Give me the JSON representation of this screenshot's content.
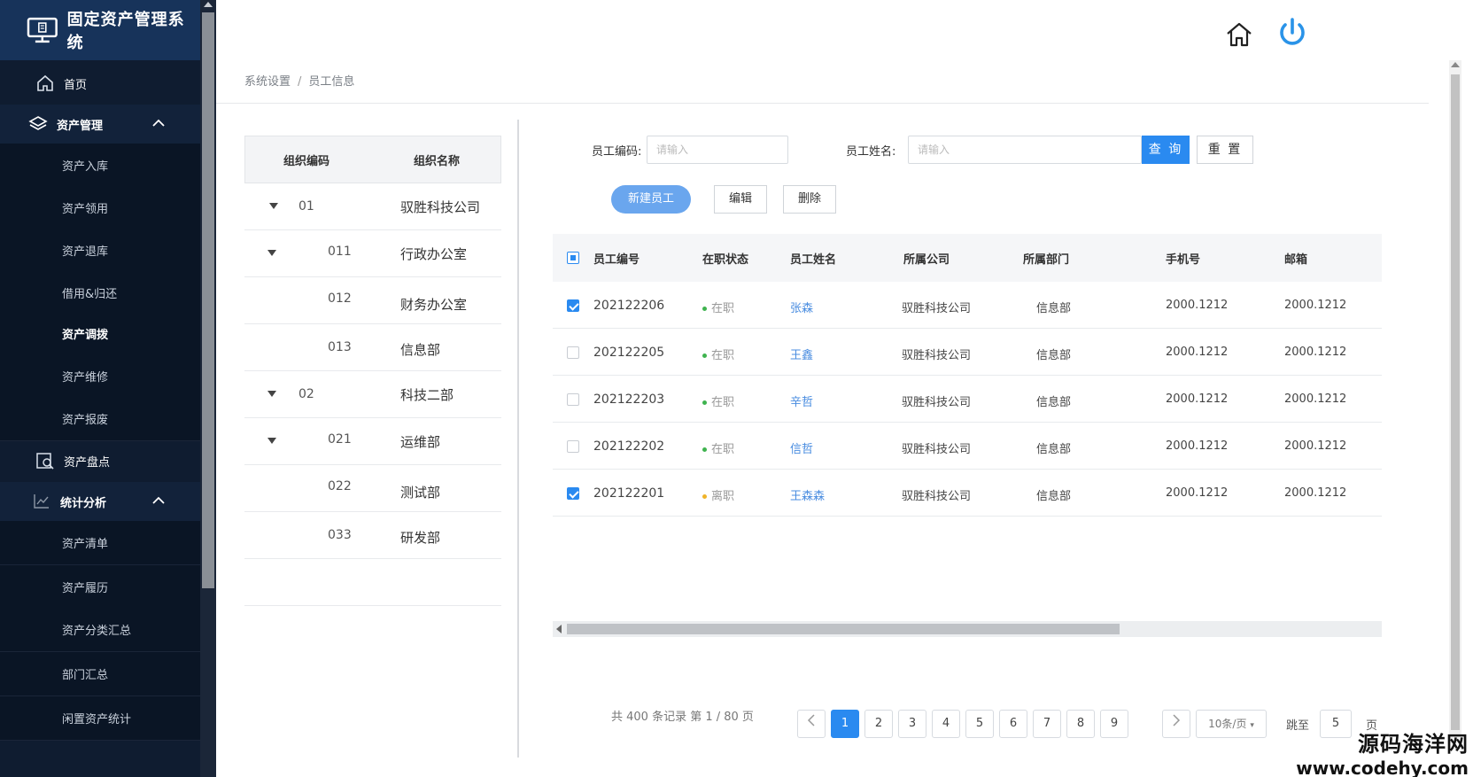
{
  "app": {
    "title": "固定资产管理系统"
  },
  "sidebar": {
    "home": "首页",
    "asset_mgmt": "资产管理",
    "asset_sub": [
      "资产入库",
      "资产领用",
      "资产退库",
      "借用&归还",
      "资产调拨",
      "资产维修",
      "资产报废"
    ],
    "inventory": "资产盘点",
    "stats": "统计分析",
    "stats_sub": [
      "资产清单",
      "资产履历",
      "资产分类汇总",
      "部门汇总",
      "闲置资产统计"
    ]
  },
  "breadcrumb": {
    "parent": "系统设置",
    "sep": "/",
    "current": "员工信息"
  },
  "org": {
    "col_code": "组织编码",
    "col_name": "组织名称",
    "rows": [
      {
        "code": "01",
        "name": "驭胜科技公司"
      },
      {
        "code": "011",
        "name": "行政办公室"
      },
      {
        "code": "012",
        "name": "财务办公室"
      },
      {
        "code": "013",
        "name": "信息部"
      },
      {
        "code": "02",
        "name": "科技二部"
      },
      {
        "code": "021",
        "name": "运维部"
      },
      {
        "code": "022",
        "name": "测试部"
      },
      {
        "code": "033",
        "name": "研发部"
      }
    ]
  },
  "search": {
    "code_label": "员工编码:",
    "code_placeholder": "请输入",
    "name_label": "员工姓名:",
    "name_placeholder": "请输入",
    "query": "查 询",
    "reset": "重 置"
  },
  "actions": {
    "new": "新建员工",
    "edit": "编辑",
    "delete": "删除"
  },
  "table": {
    "headers": [
      "员工编号",
      "在职状态",
      "员工姓名",
      "所属公司",
      "所属部门",
      "手机号",
      "邮箱"
    ],
    "rows": [
      {
        "checked": true,
        "id": "202122206",
        "status": "在职",
        "status_color": "#3fb34f",
        "name": "张森",
        "company": "驭胜科技公司",
        "dept": "信息部",
        "phone": "2000.1212",
        "email": "2000.1212"
      },
      {
        "checked": false,
        "id": "202122205",
        "status": "在职",
        "status_color": "#3fb34f",
        "name": "王鑫",
        "company": "驭胜科技公司",
        "dept": "信息部",
        "phone": "2000.1212",
        "email": "2000.1212"
      },
      {
        "checked": false,
        "id": "202122203",
        "status": "在职",
        "status_color": "#3fb34f",
        "name": "辛哲",
        "company": "驭胜科技公司",
        "dept": "信息部",
        "phone": "2000.1212",
        "email": "2000.1212"
      },
      {
        "checked": false,
        "id": "202122202",
        "status": "在职",
        "status_color": "#3fb34f",
        "name": "信哲",
        "company": "驭胜科技公司",
        "dept": "信息部",
        "phone": "2000.1212",
        "email": "2000.1212"
      },
      {
        "checked": true,
        "id": "202122201",
        "status": "离职",
        "status_color": "#f0b429",
        "name": "王森森",
        "company": "驭胜科技公司",
        "dept": "信息部",
        "phone": "2000.1212",
        "email": "2000.1212"
      }
    ]
  },
  "pagination": {
    "summary": "共 400 条记录 第 1 / 80 页",
    "pages": [
      "1",
      "2",
      "3",
      "4",
      "5",
      "6",
      "7",
      "8",
      "9"
    ],
    "current": "1",
    "page_size": "10条/页",
    "goto_label": "跳至",
    "goto_value": "5",
    "goto_unit": "页"
  },
  "watermark": {
    "line1": "源码海洋网",
    "line2": "www.codehy.com"
  },
  "colors": {
    "sidebar_bg": "#0f1c30",
    "logo_bg": "#17335a",
    "accent": "#2a8af0"
  }
}
